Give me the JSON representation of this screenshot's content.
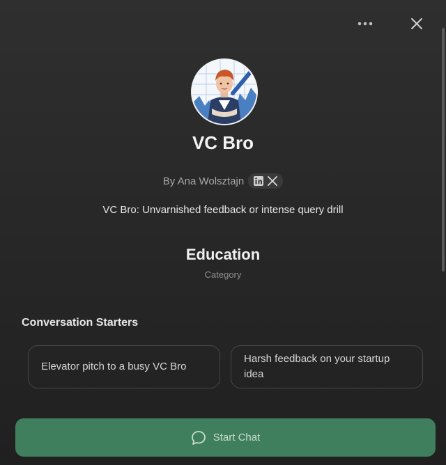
{
  "gpt": {
    "name": "VC Bro",
    "byline": "By Ana Wolsztajn",
    "description": "VC Bro: Unvarnished feedback or intense query drill"
  },
  "category": {
    "value": "Education",
    "label": "Category"
  },
  "starters": {
    "heading": "Conversation Starters",
    "items": [
      "Elevator pitch to a busy VC Bro",
      "Harsh feedback on your startup idea"
    ]
  },
  "actions": {
    "start_chat_label": "Start Chat"
  },
  "icons": {
    "more": "more-horizontal-icon",
    "close": "close-icon",
    "linkedin": "linkedin-icon",
    "x": "x-logo-icon",
    "chat": "chat-bubble-icon"
  },
  "colors": {
    "background": "#2f2f2f",
    "start_chat_button": "#3f7f5e",
    "text_primary": "#ececec",
    "text_secondary": "#a8a8a8"
  }
}
